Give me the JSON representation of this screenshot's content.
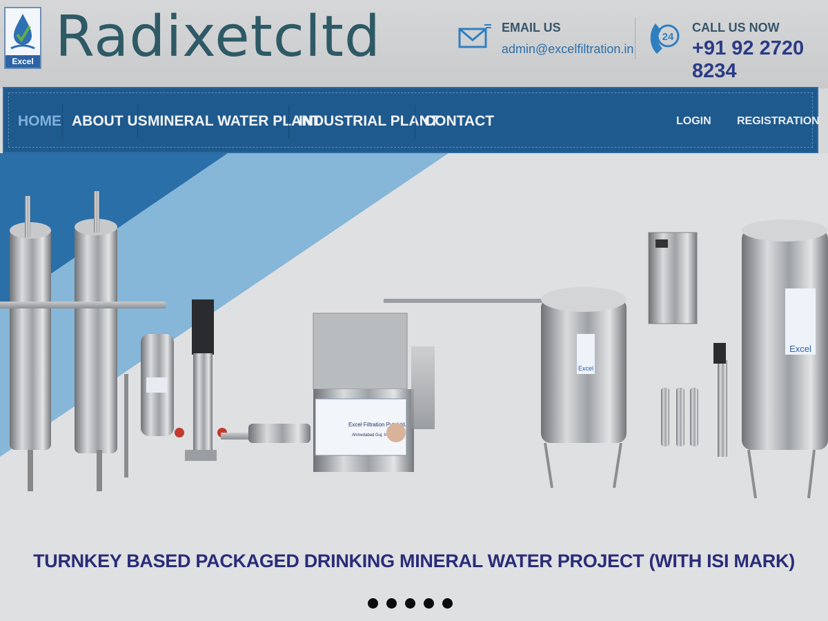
{
  "header": {
    "logo_caption": "Excel",
    "brand_name": "Radixetcltd",
    "email_label": "EMAIL US",
    "email_value": "admin@excelfiltration.in",
    "phone_label": "CALL US NOW",
    "phone_value": "+91 92 2720 8234",
    "phone_badge": "24"
  },
  "nav": {
    "items": [
      {
        "label": "HOME",
        "active": true
      },
      {
        "label": "ABOUT US",
        "active": false
      },
      {
        "label": "MINERAL WATER PLANT",
        "active": false
      },
      {
        "label": "INDUSTRIAL PLANT",
        "active": false
      },
      {
        "label": "CONTACT",
        "active": false
      }
    ],
    "login": "LOGIN",
    "registration": "REGISTRATION"
  },
  "hero": {
    "caption": "TURNKEY BASED PACKAGED DRINKING MINERAL WATER PROJECT (WITH ISI MARK)",
    "panel_brand": "Excel Filtration Pvt. Ltd.",
    "panel_city": "Ahmedabad Guj. India",
    "tank_label": "Excel",
    "slide_count": 5,
    "active_slide": 1
  },
  "colors": {
    "nav_bg": "#1f5a8e",
    "active_nav": "#7fb3dd",
    "brand_text": "#2e5a66",
    "caption_text": "#2a2c78",
    "phone_text": "#2a3b86"
  }
}
